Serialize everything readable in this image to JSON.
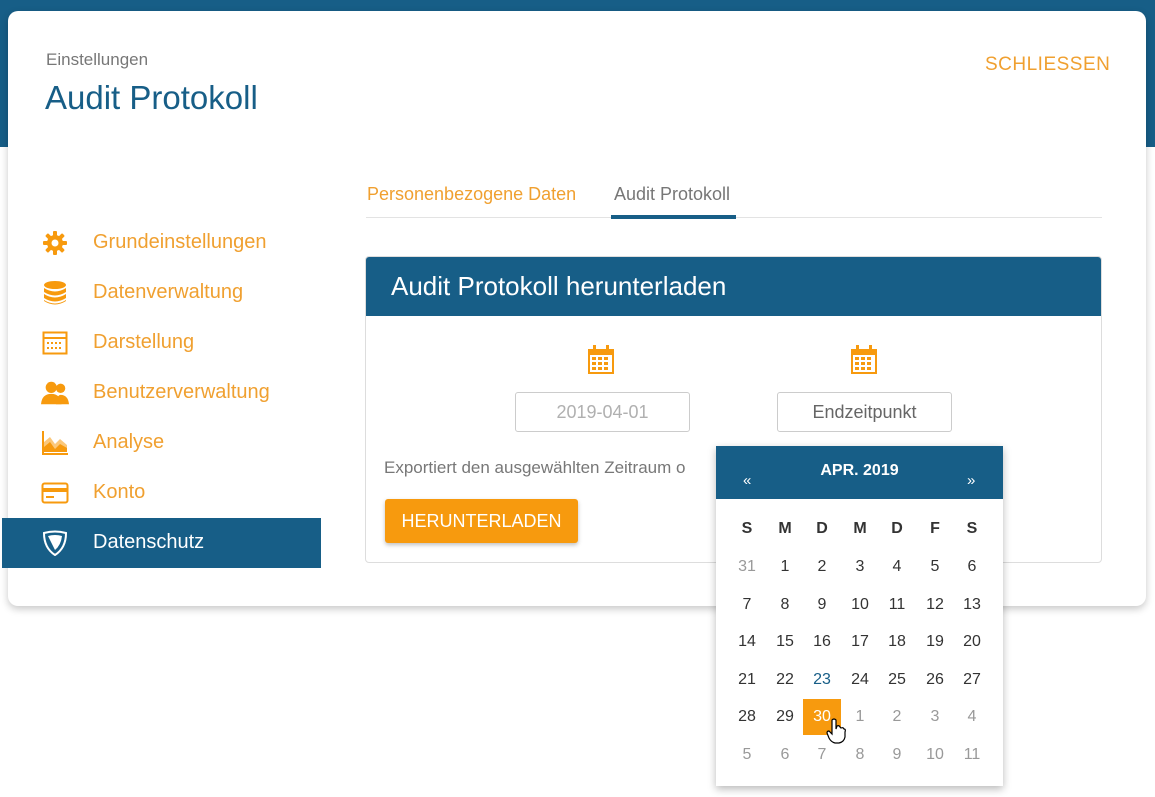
{
  "header": {
    "subtitle": "Einstellungen",
    "title": "Audit Protokoll",
    "close_label": "SCHLIESSEN"
  },
  "sidebar": {
    "items": [
      {
        "label": "Grundeinstellungen",
        "icon": "gear-icon"
      },
      {
        "label": "Datenverwaltung",
        "icon": "database-icon"
      },
      {
        "label": "Darstellung",
        "icon": "layout-icon"
      },
      {
        "label": "Benutzerverwaltung",
        "icon": "users-icon"
      },
      {
        "label": "Analyse",
        "icon": "chart-icon"
      },
      {
        "label": "Konto",
        "icon": "credit-card-icon"
      },
      {
        "label": "Datenschutz",
        "icon": "shield-icon",
        "active": true
      }
    ]
  },
  "tabs": [
    {
      "label": "Personenbezogene Daten"
    },
    {
      "label": "Audit Protokoll",
      "active": true
    }
  ],
  "panel": {
    "title": "Audit Protokoll herunterladen",
    "start_value": "2019-04-01",
    "end_placeholder": "Endzeitpunkt",
    "export_text": "Exportiert den ausgewählten Zeitraum o",
    "download_label": "HERUNTERLADEN"
  },
  "datepicker": {
    "month_label": "APR. 2019",
    "prev": "«",
    "next": "»",
    "weekdays": [
      "S",
      "M",
      "D",
      "M",
      "D",
      "F",
      "S"
    ],
    "weeks": [
      [
        "31",
        "1",
        "2",
        "3",
        "4",
        "5",
        "6"
      ],
      [
        "7",
        "8",
        "9",
        "10",
        "11",
        "12",
        "13"
      ],
      [
        "14",
        "15",
        "16",
        "17",
        "18",
        "19",
        "20"
      ],
      [
        "21",
        "22",
        "23",
        "24",
        "25",
        "26",
        "27"
      ],
      [
        "28",
        "29",
        "30",
        "1",
        "2",
        "3",
        "4"
      ],
      [
        "5",
        "6",
        "7",
        "8",
        "9",
        "10",
        "11"
      ]
    ],
    "today": "23",
    "selected": "30"
  },
  "colors": {
    "primary": "#175e87",
    "accent": "#f79a0e",
    "accent_text": "#f0a030"
  }
}
